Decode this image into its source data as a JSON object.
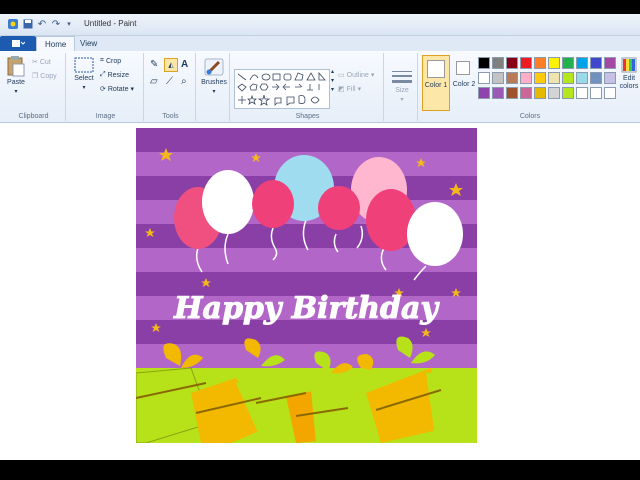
{
  "window": {
    "title": "Untitled - Paint"
  },
  "tabs": [
    {
      "label": "Home"
    },
    {
      "label": "View"
    }
  ],
  "clipboard": {
    "paste": "Paste",
    "cut": "Cut",
    "copy": "Copy",
    "label": "Clipboard"
  },
  "image": {
    "select": "Select",
    "crop": "Crop",
    "resize": "Resize",
    "rotate": "Rotate",
    "label": "Image"
  },
  "tools": {
    "label": "Tools",
    "brushes": "Brushes"
  },
  "shapes": {
    "outline": "Outline",
    "fill": "Fill",
    "label": "Shapes"
  },
  "size": {
    "label": "Size"
  },
  "colors": {
    "color1": "Color 1",
    "color2": "Color 2",
    "edit": "Edit colors",
    "label": "Colors",
    "row1": [
      "#000000",
      "#7f7f7f",
      "#880015",
      "#ed1c24",
      "#ff7f27",
      "#fff200",
      "#22b14c",
      "#00a2e8",
      "#3f48cc",
      "#a349a4"
    ],
    "row2": [
      "#ffffff",
      "#c3c3c3",
      "#b97a57",
      "#ffaec9",
      "#ffc90e",
      "#efe4b0",
      "#b5e61d",
      "#99d9ea",
      "#7092be",
      "#c8bfe7"
    ],
    "row3": [
      "#8e44ad",
      "#9b59b6",
      "#a0522d",
      "#cc6699",
      "#e6b800",
      "#d4d4d4",
      "#b5e61d",
      "#ffffff",
      "#ffffff",
      "#ffffff"
    ]
  },
  "card": {
    "greeting": "Happy Birthday",
    "stripe_dark": "#8a3fa6",
    "stripe_light": "#b266c8",
    "balloon_colors": [
      "#f0507f",
      "#ffffff",
      "#9fdcf0",
      "#ffb6cf",
      "#f0407a"
    ],
    "gift_colors": [
      "#b7e21a",
      "#f2b900",
      "#f4a600"
    ]
  }
}
